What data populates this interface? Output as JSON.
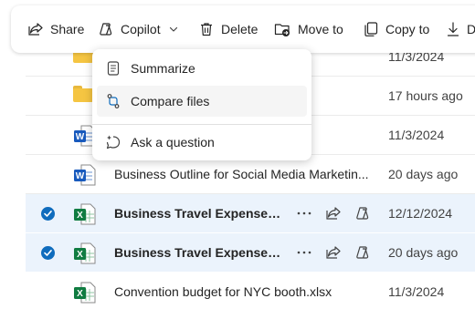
{
  "toolbar": {
    "share_label": "Share",
    "copilot_label": "Copilot",
    "delete_label": "Delete",
    "move_label": "Move to",
    "copy_label": "Copy to",
    "download_label": "D"
  },
  "copilot_menu": {
    "items": [
      {
        "label": "Summarize",
        "icon": "summarize-icon"
      },
      {
        "label": "Compare files",
        "icon": "compare-files-icon"
      },
      {
        "label": "Ask a question",
        "icon": "ask-question-icon"
      }
    ]
  },
  "files": [
    {
      "type": "folder",
      "name": "",
      "date": "11/3/2024",
      "selected": false
    },
    {
      "type": "folder",
      "name": "",
      "date": "17 hours ago",
      "selected": false
    },
    {
      "type": "word",
      "name": "",
      "date": "11/3/2024",
      "selected": false
    },
    {
      "type": "word",
      "name": "Business Outline for Social Media Marketin...",
      "date": "20 days ago",
      "selected": false
    },
    {
      "type": "excel",
      "name": "Business Travel Expenses Bu...",
      "date": "12/12/2024",
      "selected": true
    },
    {
      "type": "excel",
      "name": "Business Travel Expenses Bu...",
      "date": "20 days ago",
      "selected": true
    },
    {
      "type": "excel",
      "name": "Convention budget for NYC booth.xlsx",
      "date": "11/3/2024",
      "selected": false
    }
  ],
  "colors": {
    "accent": "#0f6cbd",
    "selected_row": "#ebf3fc",
    "excel_green": "#107c41",
    "word_blue": "#185abd",
    "folder_yellow": "#f5c542"
  }
}
